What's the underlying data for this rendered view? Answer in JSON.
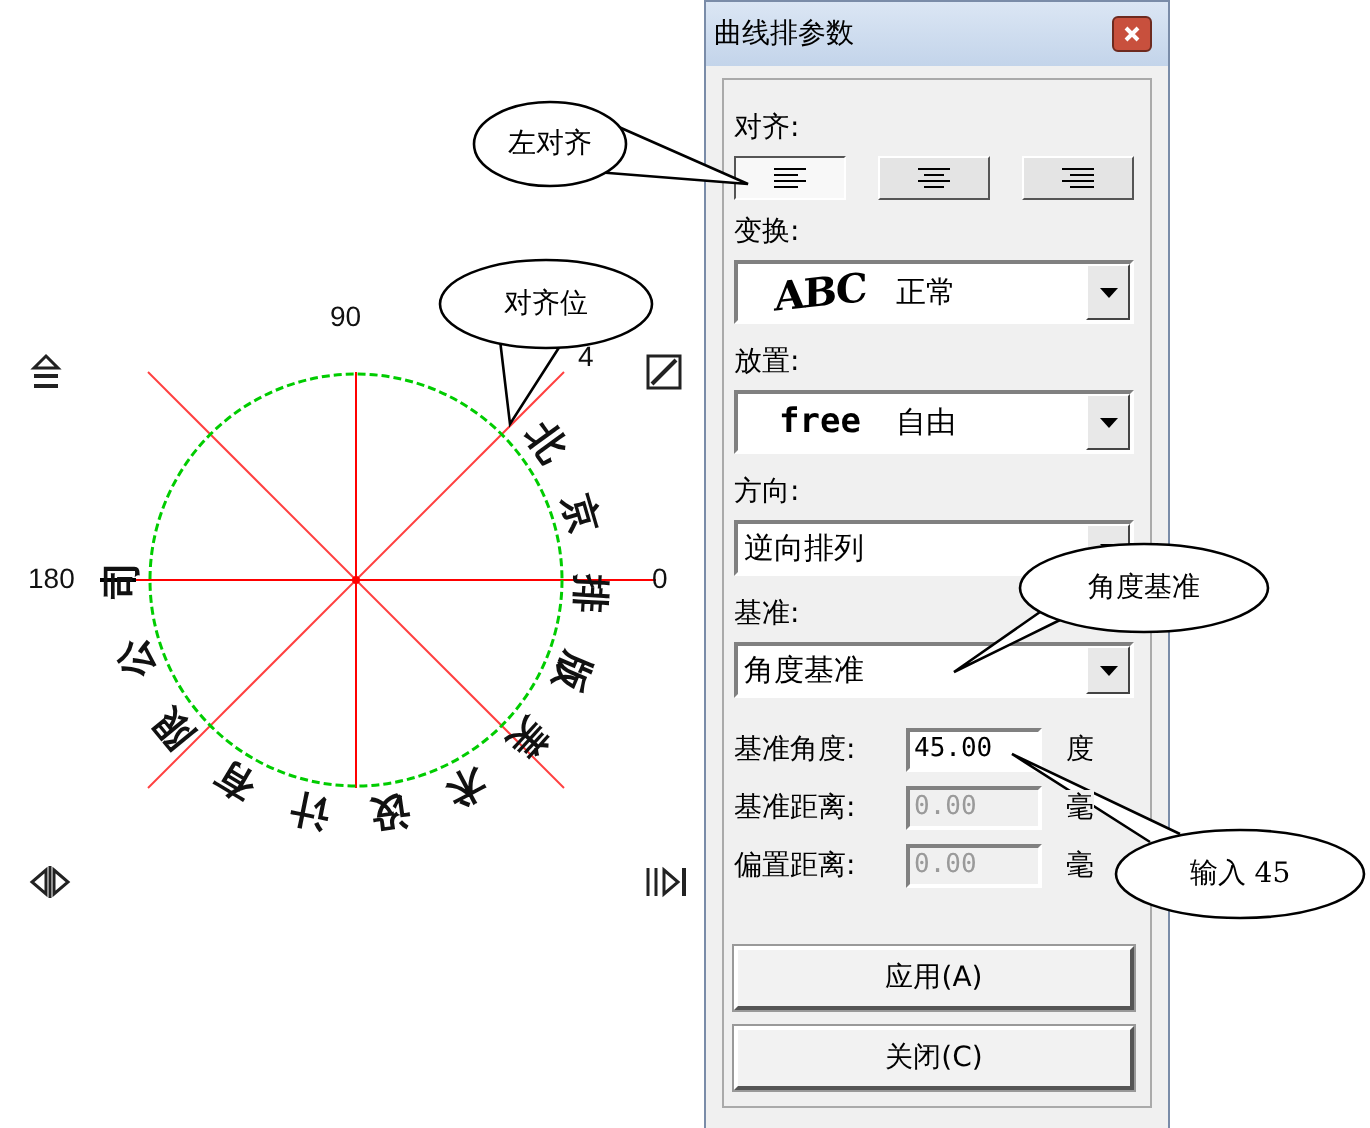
{
  "diagram": {
    "angle_labels": [
      {
        "text": "90",
        "kind": "top"
      },
      {
        "text": "4",
        "kind": "diag"
      },
      {
        "text": "180",
        "kind": "left"
      },
      {
        "text": "0",
        "kind": "right"
      }
    ],
    "curve_text": "北京排版美术设计有限公司"
  },
  "dialog": {
    "title": "曲线排参数",
    "align": {
      "label": "对齐:",
      "buttons": [
        {
          "kind": "left",
          "selected": true
        },
        {
          "kind": "center",
          "selected": false
        },
        {
          "kind": "right",
          "selected": false
        }
      ]
    },
    "combos": [
      {
        "label": "变换:",
        "sample": "ABC",
        "value": "正常",
        "kind": "sample"
      },
      {
        "label": "放置:",
        "sample": "free",
        "value": "自由",
        "kind": "sample"
      },
      {
        "label": "方向:",
        "value": "逆向排列",
        "kind": "plain"
      },
      {
        "label": "基准:",
        "value": "角度基准",
        "kind": "plain"
      }
    ],
    "fields": [
      {
        "label": "基准角度:",
        "value": "45.00",
        "unit": "度",
        "disabled": false
      },
      {
        "label": "基准距离:",
        "value": "0.00",
        "unit": "毫",
        "disabled": true
      },
      {
        "label": "偏置距离:",
        "value": "0.00",
        "unit": "毫",
        "disabled": true
      }
    ],
    "buttons": [
      "应用(A)",
      "关闭(C)"
    ]
  },
  "callouts": [
    {
      "text": "左对齐"
    },
    {
      "text": "对齐位"
    },
    {
      "text": "角度基准"
    },
    {
      "text": "输入 45"
    }
  ]
}
